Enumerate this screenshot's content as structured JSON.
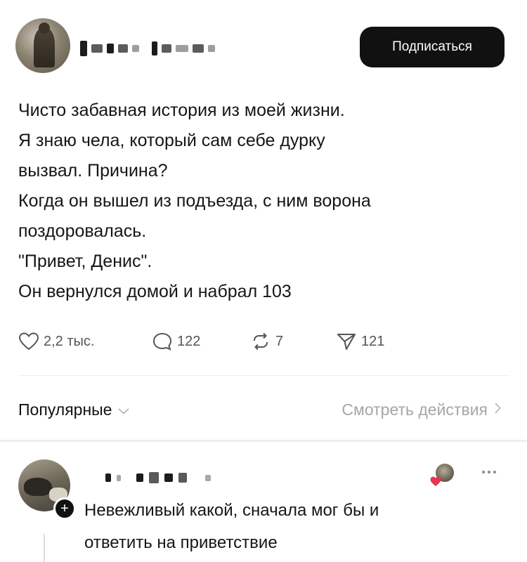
{
  "post": {
    "subscribe_label": "Подписаться",
    "text_lines": [
      "Чисто забавная история из моей жизни.",
      "Я знаю чела, который сам себе дурку",
      "вызвал. Причина?",
      "Когда он вышел из подъезда, с ним ворона",
      "поздоровалась.",
      "\"Привет, Денис\".",
      "Он вернулся домой и набрал 103"
    ],
    "stats": {
      "likes": "2,2 тыс.",
      "comments": "122",
      "reposts": "7",
      "shares": "121"
    },
    "icons": {
      "like": "heart-icon",
      "comment": "comment-bubble-icon",
      "repost": "repost-icon",
      "share": "send-icon"
    }
  },
  "comments_bar": {
    "sort_label": "Популярные",
    "view_actions_label": "Смотреть действия"
  },
  "comment": {
    "text_lines": [
      "Невежливый какой, сначала мог бы и",
      "ответить на приветствие"
    ],
    "follow_symbol": "+"
  },
  "colors": {
    "button_bg": "#111111",
    "button_text": "#ffffff",
    "muted": "#a6a6a6",
    "liked_heart": "#e8344e"
  }
}
